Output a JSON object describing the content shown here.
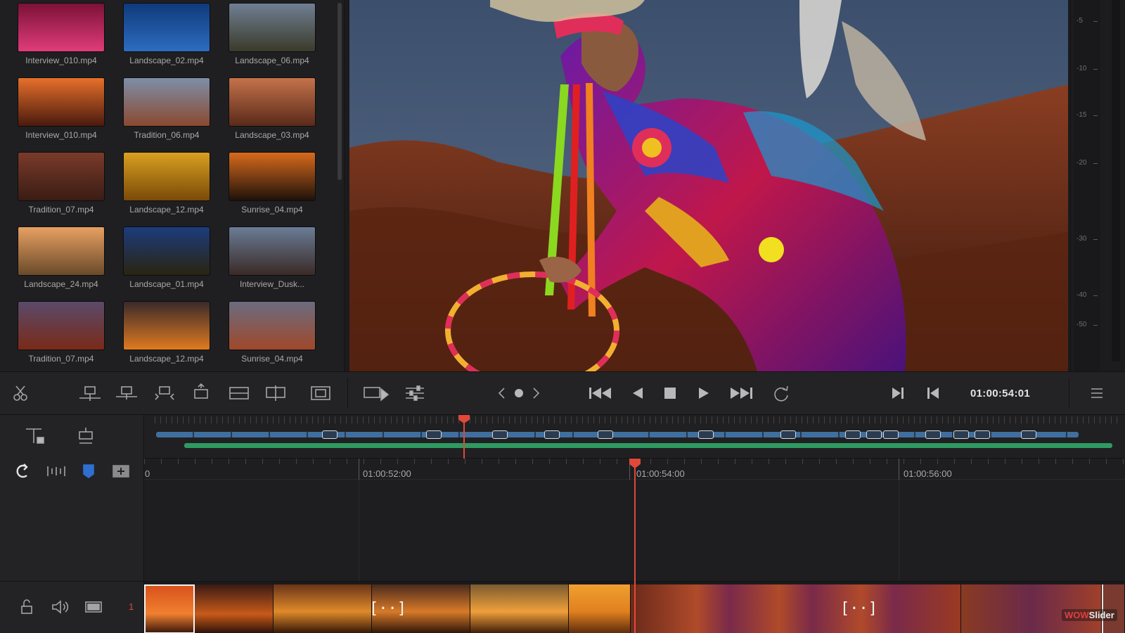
{
  "media_pool": {
    "clips": [
      {
        "name": "Interview_010.mp4",
        "thumb": [
          "#7b1136",
          "#e03c7a"
        ]
      },
      {
        "name": "Landscape_02.mp4",
        "thumb": [
          "#0f3a7a",
          "#2d6cc0"
        ]
      },
      {
        "name": "Landscape_06.mp4",
        "thumb": [
          "#6f7f93",
          "#3b3a2a"
        ]
      },
      {
        "name": "Interview_010.mp4",
        "thumb": [
          "#e6702a",
          "#4a1a0e"
        ]
      },
      {
        "name": "Tradition_06.mp4",
        "thumb": [
          "#7d8ea8",
          "#8a4a30"
        ]
      },
      {
        "name": "Landscape_03.mp4",
        "thumb": [
          "#c4724a",
          "#5a2a1a"
        ]
      },
      {
        "name": "Tradition_07.mp4",
        "thumb": [
          "#7a3a2a",
          "#3a1c14"
        ]
      },
      {
        "name": "Landscape_12.mp4",
        "thumb": [
          "#d9a020",
          "#7a4a08"
        ]
      },
      {
        "name": "Sunrise_04.mp4",
        "thumb": [
          "#d86a1c",
          "#1e120a"
        ]
      },
      {
        "name": "Landscape_24.mp4",
        "thumb": [
          "#e7a062",
          "#6a4a2a"
        ]
      },
      {
        "name": "Landscape_01.mp4",
        "thumb": [
          "#1c3c7c",
          "#2a2410"
        ]
      },
      {
        "name": "Interview_Dusk...",
        "thumb": [
          "#6a7c96",
          "#3a2a26"
        ]
      },
      {
        "name": "Tradition_07.mp4",
        "thumb": [
          "#5a4a6a",
          "#7a2a18"
        ]
      },
      {
        "name": "Landscape_12.mp4",
        "thumb": [
          "#3a2a2a",
          "#e07a20"
        ]
      },
      {
        "name": "Sunrise_04.mp4",
        "thumb": [
          "#6a6c80",
          "#a0482a"
        ]
      }
    ]
  },
  "audio_meter": {
    "ticks": [
      "-5",
      "-10",
      "-15",
      "-20",
      "-30",
      "-40",
      "-50"
    ]
  },
  "toolbar": {
    "timecode": "01:00:54:01",
    "icons": [
      "scissors-icon",
      "insert-clip-icon",
      "overwrite-clip-icon",
      "replace-clip-icon",
      "place-on-top-icon",
      "append-icon",
      "ripple-overwrite-icon",
      "close-up-icon",
      "source-tape-icon",
      "sync-settings-icon",
      "prev-clip-icon",
      "mark-dot-icon",
      "next-clip-icon",
      "go-to-start-icon",
      "reverse-play-icon",
      "stop-icon",
      "play-icon",
      "go-to-end-icon",
      "loop-icon",
      "mark-in-icon",
      "mark-out-icon",
      "menu-icon"
    ]
  },
  "timeline": {
    "ruler_labels": [
      "0",
      "01:00:52:00",
      "01:00:54:00",
      "01:00:56:00"
    ],
    "track_number": "1",
    "transition_glyph": "[··]"
  },
  "colors": {
    "accent_red": "#e0483a",
    "track_blue": "#3f6f9e",
    "track_green": "#2e9a62"
  },
  "watermark": {
    "prefix": "WOW",
    "suffix": "Slider"
  }
}
